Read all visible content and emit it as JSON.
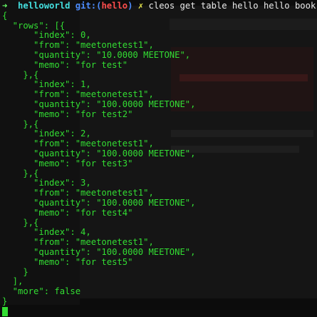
{
  "prompt": {
    "arrow": "➜",
    "directory": "helloworld",
    "git_label": "git:",
    "branch_open": "(",
    "branch": "hello",
    "branch_close": ")",
    "dirty_mark": "✗",
    "command": "cleos get table hello hello book"
  },
  "output": [
    "{",
    "  \"rows\": [{",
    "      \"index\": 0,",
    "      \"from\": \"meetonetest1\",",
    "      \"quantity\": \"10.0000 MEETONE\",",
    "      \"memo\": \"for test\"",
    "    },{",
    "      \"index\": 1,",
    "      \"from\": \"meetonetest1\",",
    "      \"quantity\": \"100.0000 MEETONE\",",
    "      \"memo\": \"for test2\"",
    "    },{",
    "      \"index\": 2,",
    "      \"from\": \"meetonetest1\",",
    "      \"quantity\": \"100.0000 MEETONE\",",
    "      \"memo\": \"for test3\"",
    "    },{",
    "      \"index\": 3,",
    "      \"from\": \"meetonetest1\",",
    "      \"quantity\": \"100.0000 MEETONE\",",
    "      \"memo\": \"for test4\"",
    "    },{",
    "      \"index\": 4,",
    "      \"from\": \"meetonetest1\",",
    "      \"quantity\": \"100.0000 MEETONE\",",
    "      \"memo\": \"for test5\"",
    "    }",
    "  ],",
    "  \"more\": false",
    "}"
  ],
  "colors": {
    "text": "#33dd33",
    "directory": "#44e0e0",
    "git": "#4d8dff",
    "branch": "#ff4d4d",
    "dirty": "#e8e84d",
    "background": "#0c0c0c"
  }
}
